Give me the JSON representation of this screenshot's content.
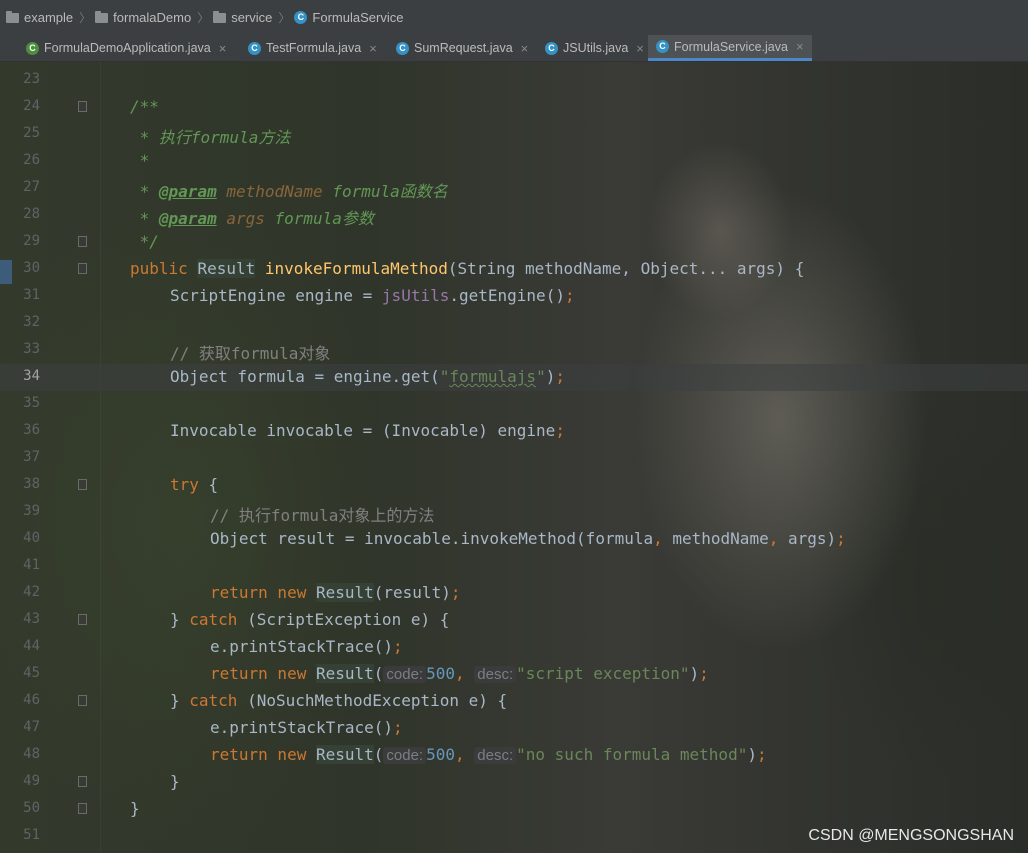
{
  "breadcrumb": {
    "items": [
      "example",
      "formalaDemo",
      "service",
      "FormulaService"
    ]
  },
  "tabs": [
    {
      "label": "FormulaDemoApplication.java",
      "close": "×"
    },
    {
      "label": "TestFormula.java",
      "close": "×"
    },
    {
      "label": "SumRequest.java",
      "close": "×"
    },
    {
      "label": "JSUtils.java",
      "close": "×"
    },
    {
      "label": "FormulaService.java",
      "close": "×"
    }
  ],
  "editor": {
    "current_line": 34,
    "lines": [
      {
        "n": "23"
      },
      {
        "n": "24",
        "t": {
          "a": "/**"
        }
      },
      {
        "n": "25",
        "t": {
          "a": " * 执行formula方法"
        }
      },
      {
        "n": "26",
        "t": {
          "a": " *"
        }
      },
      {
        "n": "27",
        "t": {
          "a": " * ",
          "tag": "@param",
          "p": "methodName",
          "b": " formula函数名"
        }
      },
      {
        "n": "28",
        "t": {
          "a": " * ",
          "tag": "@param",
          "p": "args",
          "b": " formula参数"
        }
      },
      {
        "n": "29",
        "t": {
          "a": " */"
        }
      },
      {
        "n": "30",
        "t": {
          "kw": "public ",
          "type": "Result",
          "sp": " ",
          "fn": "invokeFormulaMethod",
          "rest": "(String methodName, Object... args) {"
        }
      },
      {
        "n": "31",
        "t": {
          "a": "ScriptEngine engine = ",
          "field": "jsUtils",
          "b": ".getEngine()",
          "semi": ";"
        }
      },
      {
        "n": "32"
      },
      {
        "n": "33",
        "t": {
          "a": "// 获取formula对象"
        }
      },
      {
        "n": "34",
        "t": {
          "a": "Object formula = engine.get(",
          "q1": "\"",
          "s": "formulajs",
          "q2": "\"",
          "b": ")",
          "semi": ";"
        }
      },
      {
        "n": "35"
      },
      {
        "n": "36",
        "t": {
          "a": "Invocable invocable = (Invocable) engine",
          "semi": ";"
        }
      },
      {
        "n": "37"
      },
      {
        "n": "38",
        "t": {
          "kw": "try",
          "a": " {"
        }
      },
      {
        "n": "39",
        "t": {
          "a": "// 执行formula对象上的方法"
        }
      },
      {
        "n": "40",
        "t": {
          "a": "Object result = invocable.invokeMethod(formula",
          "c1": ", ",
          "b": "methodName",
          "c2": ", ",
          "d": "args)",
          "semi": ";"
        }
      },
      {
        "n": "41"
      },
      {
        "n": "42",
        "t": {
          "kw": "return new ",
          "type": "Result",
          "a": "(result)",
          "semi": ";"
        }
      },
      {
        "n": "43",
        "t": {
          "a": "} ",
          "kw": "catch",
          "b": " (ScriptException e) {"
        }
      },
      {
        "n": "44",
        "t": {
          "a": "e.printStackTrace()",
          "semi": ";"
        }
      },
      {
        "n": "45",
        "t": {
          "kw": "return new ",
          "type": "Result",
          "a": "(",
          "h1": "code:",
          "num": "500",
          "c": ", ",
          "h2": "desc:",
          "s": "\"script exception\"",
          "b": ")",
          "semi": ";"
        }
      },
      {
        "n": "46",
        "t": {
          "a": "} ",
          "kw": "catch",
          "b": " (NoSuchMethodException e) {"
        }
      },
      {
        "n": "47",
        "t": {
          "a": "e.printStackTrace()",
          "semi": ";"
        }
      },
      {
        "n": "48",
        "t": {
          "kw": "return new ",
          "type": "Result",
          "a": "(",
          "h1": "code:",
          "num": "500",
          "c": ", ",
          "h2": "desc:",
          "s": "\"no such formula method\"",
          "b": ")",
          "semi": ";"
        }
      },
      {
        "n": "49",
        "t": {
          "a": "}"
        }
      },
      {
        "n": "50",
        "t": {
          "a": "}"
        }
      },
      {
        "n": "51"
      }
    ]
  },
  "watermark": "CSDN @MENGSONGSHAN",
  "colors": {
    "keyword": "#cc7832",
    "comment": "#808080",
    "javadoc": "#629755",
    "string": "#6a8759",
    "number": "#6897bb",
    "function": "#ffc66d",
    "field": "#9876aa",
    "active_tab_underline": "#4a88c7"
  },
  "icons": [
    "folder-icon",
    "class-icon",
    "close-icon",
    "fold-marker-icon"
  ]
}
